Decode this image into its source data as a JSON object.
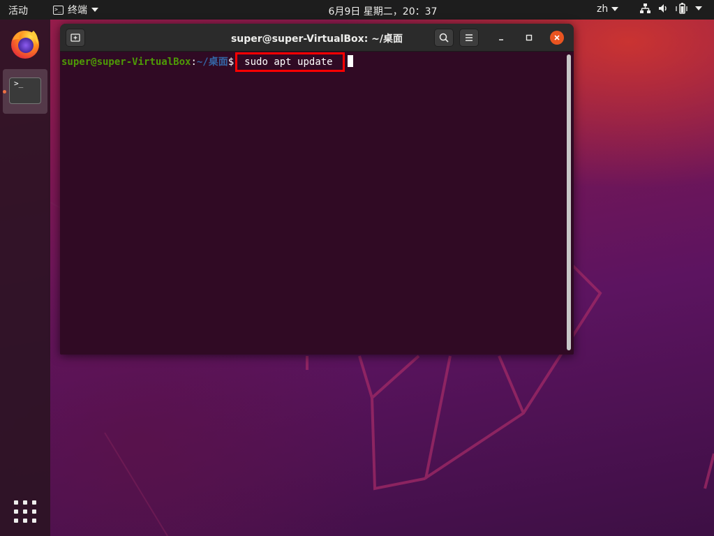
{
  "topbar": {
    "activities": "活动",
    "app_name": "终端",
    "app_icon_glyph": ">_",
    "clock": "6月9日 星期二，20：37",
    "language": "zh"
  },
  "dock": {
    "items": [
      {
        "name": "firefox",
        "label": "Firefox"
      },
      {
        "name": "terminal",
        "label": "终端",
        "glyph": ">_"
      }
    ]
  },
  "terminal": {
    "title": "super@super-VirtualBox: ~/桌面",
    "prompt_user": "super@super-VirtualBox",
    "prompt_colon": ":",
    "prompt_path": "~/桌面",
    "prompt_symbol": "$",
    "command": "sudo apt update"
  },
  "colors": {
    "terminal_bg": "#300a24",
    "prompt_user": "#4e9a06",
    "prompt_path": "#3465a4",
    "highlight_box": "#ff0000",
    "ubuntu_orange": "#e95420"
  }
}
